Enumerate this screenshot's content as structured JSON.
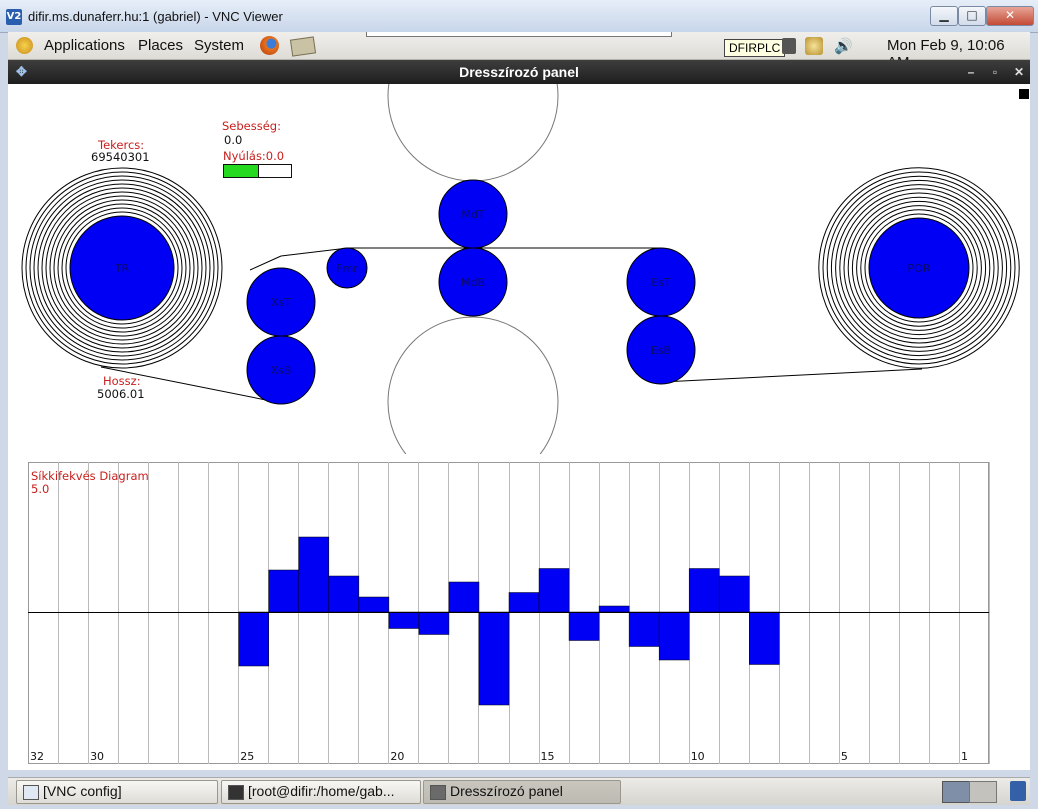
{
  "vnc_window": {
    "title": "difir.ms.dunaferr.hu:1 (gabriel) - VNC Viewer",
    "logo": "V2"
  },
  "panel": {
    "menus": [
      "Applications",
      "Places",
      "System"
    ],
    "tooltip": "DFIRPLC",
    "clock": "Mon Feb  9, 10:06 AM"
  },
  "app": {
    "title": "Dresszírozó panel",
    "tekercs_label": "Tekercs:",
    "tekercs_value": "69540301",
    "sebesseg_label": "Sebesség:",
    "sebesseg_value": "0.0",
    "nyulas_label": "Nyúlás:0.0",
    "speed_bar_fraction": 0.5,
    "hossz_label": "Hossz:",
    "hossz_value": "5006.01",
    "rolls": {
      "TR": "TR",
      "XsT": "XsT",
      "XsB": "XsB",
      "Fmr": "Fmr",
      "MdT": "MdT",
      "MdB": "MdB",
      "EsT": "EsT",
      "EsB": "EsB",
      "POR": "POR"
    }
  },
  "chart_data": {
    "type": "bar",
    "title": "Síkkifekvés Diagram",
    "scale_label": "5.0",
    "categories": [
      25,
      24,
      23,
      22,
      21,
      20,
      19,
      18,
      17,
      16,
      15,
      14,
      13,
      12,
      11,
      10,
      9,
      8
    ],
    "values": [
      -1.8,
      1.4,
      2.5,
      1.2,
      0.5,
      -0.55,
      -0.75,
      1.0,
      -3.1,
      0.65,
      1.45,
      -0.95,
      0.2,
      -1.15,
      -1.6,
      1.45,
      1.2,
      -1.75
    ],
    "x_range": [
      32,
      1
    ],
    "y_range": [
      -5.0,
      5.0
    ],
    "tick_labels": [
      "32",
      "30",
      "25",
      "20",
      "15",
      "10",
      "5",
      "1"
    ],
    "grid": true
  },
  "taskbar": {
    "tasks": [
      "[VNC config]",
      "[root@difir:/home/gab...",
      "Dresszírozó panel"
    ]
  }
}
